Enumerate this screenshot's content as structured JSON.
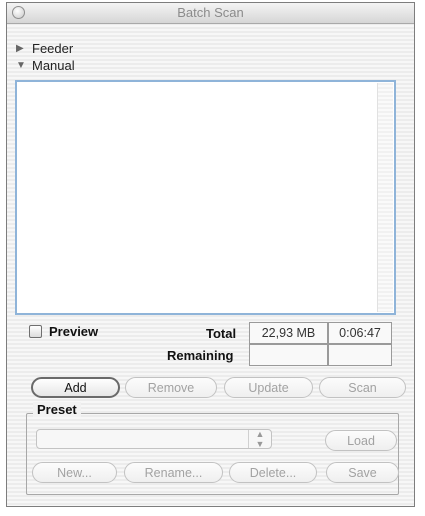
{
  "window": {
    "title": "Batch Scan"
  },
  "sections": {
    "feeder_label": "Feeder",
    "manual_label": "Manual"
  },
  "preview": {
    "label": "Preview",
    "checked": false
  },
  "stats": {
    "total_label": "Total",
    "total_size": "22,93 MB",
    "total_time": "0:06:47",
    "remaining_label": "Remaining",
    "remaining_size": "",
    "remaining_time": ""
  },
  "actions": {
    "add": "Add",
    "remove": "Remove",
    "update": "Update",
    "scan": "Scan"
  },
  "preset": {
    "title": "Preset",
    "selected": "",
    "load": "Load",
    "new": "New...",
    "rename": "Rename...",
    "delete": "Delete...",
    "save": "Save"
  },
  "icons": {
    "close": "close-icon",
    "feeder": "disclosure-closed-icon",
    "manual": "disclosure-open-icon",
    "popup": "popup-arrows-icon"
  }
}
